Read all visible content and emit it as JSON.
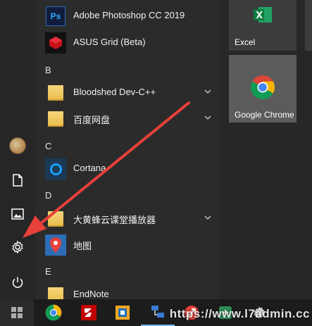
{
  "apps": {
    "photoshop": "Adobe Photoshop CC 2019",
    "asus_grid": "ASUS Grid (Beta)",
    "bloodshed": "Bloodshed Dev-C++",
    "baidu_pan": "百度网盘",
    "cortana": "Cortana",
    "dahuang": "大黄蜂云课堂播放器",
    "ditu": "地图",
    "endnote": "EndNote"
  },
  "letters": {
    "b": "B",
    "c": "C",
    "d": "D",
    "e": "E"
  },
  "icons": {
    "photoshop_glyph": "Ps"
  },
  "tiles": {
    "excel": "Excel",
    "chrome": "Google Chrome"
  },
  "watermark": "https://www.l7admin.cc",
  "colors": {
    "accent": "#e8403a",
    "chrome_tile": "#5b5b5b",
    "excel_green": "#1d6f42"
  }
}
